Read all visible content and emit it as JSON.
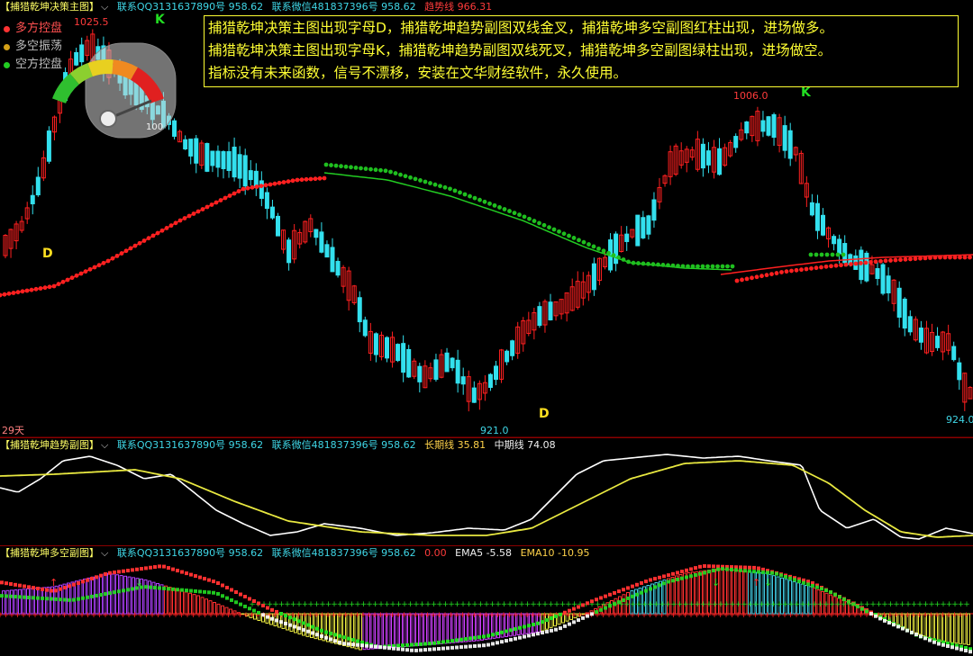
{
  "main_pane": {
    "title": "【捕猎乾坤决策主图】",
    "contact_qq": "联系QQ3131637890号 958.62",
    "contact_wechat": "联系微信481837396号 958.62",
    "trend_line_text": "趋势线 966.31",
    "legend": [
      {
        "label": "多方控盘",
        "color": "#ff3333"
      },
      {
        "label": "多空振荡",
        "color": "#d4a017"
      },
      {
        "label": "空方控盘",
        "color": "#22cc22"
      }
    ],
    "note_lines": [
      "捕猎乾坤决策主图出现字母D，捕猎乾坤趋势副图双线金叉，捕猎乾坤多空副图红柱出现，进场做多。",
      "捕猎乾坤决策主图出现字母K，捕猎乾坤趋势副图双线死叉，捕猎乾坤多空副图绿柱出现，进场做空。",
      "指标没有未来函数，信号不漂移，安装在文华财经软件，永久使用。"
    ],
    "price_labels": {
      "high_left": "1025.5",
      "high_right": "1006.0",
      "low_mid": "921.0",
      "low_right": "924.0",
      "gauge": "100"
    },
    "signals": {
      "k1": "K",
      "d1": "D",
      "d2": "D",
      "k2": "K"
    },
    "period_label": "29天"
  },
  "trend_pane": {
    "title": "【捕猎乾坤趋势副图】",
    "contact_qq": "联系QQ3131637890号 958.62",
    "contact_wechat": "联系微信481837396号 958.62",
    "long_line": "长期线 35.81",
    "mid_line": "中期线 74.08"
  },
  "power_pane": {
    "title": "【捕猎乾坤多空副图】",
    "contact_qq": "联系QQ3131637890号 958.62",
    "contact_wechat": "联系微信481837396号 958.62",
    "zero_value": "0.00",
    "ema5": "EMA5 -5.58",
    "ema10": "EMA10 -10.95"
  },
  "colors": {
    "bull": "#ff2020",
    "bear": "#33e0ee",
    "line_white": "#ffffff",
    "line_yellow": "#e8e840",
    "dots_red": "#ff2020",
    "dots_green": "#1fbf1f",
    "ma_green": "#22cc22"
  }
}
